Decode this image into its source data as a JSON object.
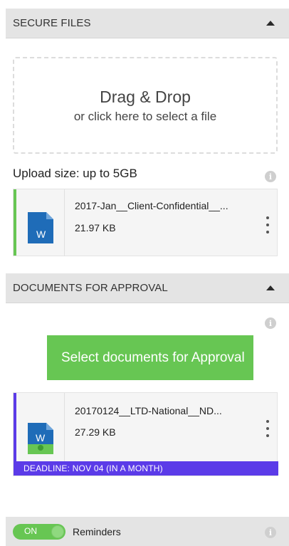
{
  "secure_files": {
    "header": "SECURE FILES",
    "dropzone_title": "Drag & Drop",
    "dropzone_subtitle": "or click here to select a file",
    "upload_size": "Upload size: up to 5GB",
    "file": {
      "name": "2017-Jan__Client-Confidential__...",
      "size": "21.97 KB",
      "icon": "word-document-icon",
      "accent_color": "#67c653"
    }
  },
  "approval": {
    "header": "DOCUMENTS FOR APPROVAL",
    "button_label": "Select documents for Approval",
    "file": {
      "name": "20170124__LTD-National__ND...",
      "size": "27.29 KB",
      "icon": "word-document-approval-icon",
      "accent_color": "#5b3be8",
      "deadline": "DEADLINE: NOV 04 (IN A MONTH)"
    }
  },
  "footer": {
    "toggle_label": "ON",
    "toggle_state": true,
    "reminders_label": "Reminders"
  },
  "colors": {
    "header_bg": "#e4e4e4",
    "green": "#67c653",
    "purple": "#5b3be8",
    "word_blue": "#1f6cb8"
  }
}
